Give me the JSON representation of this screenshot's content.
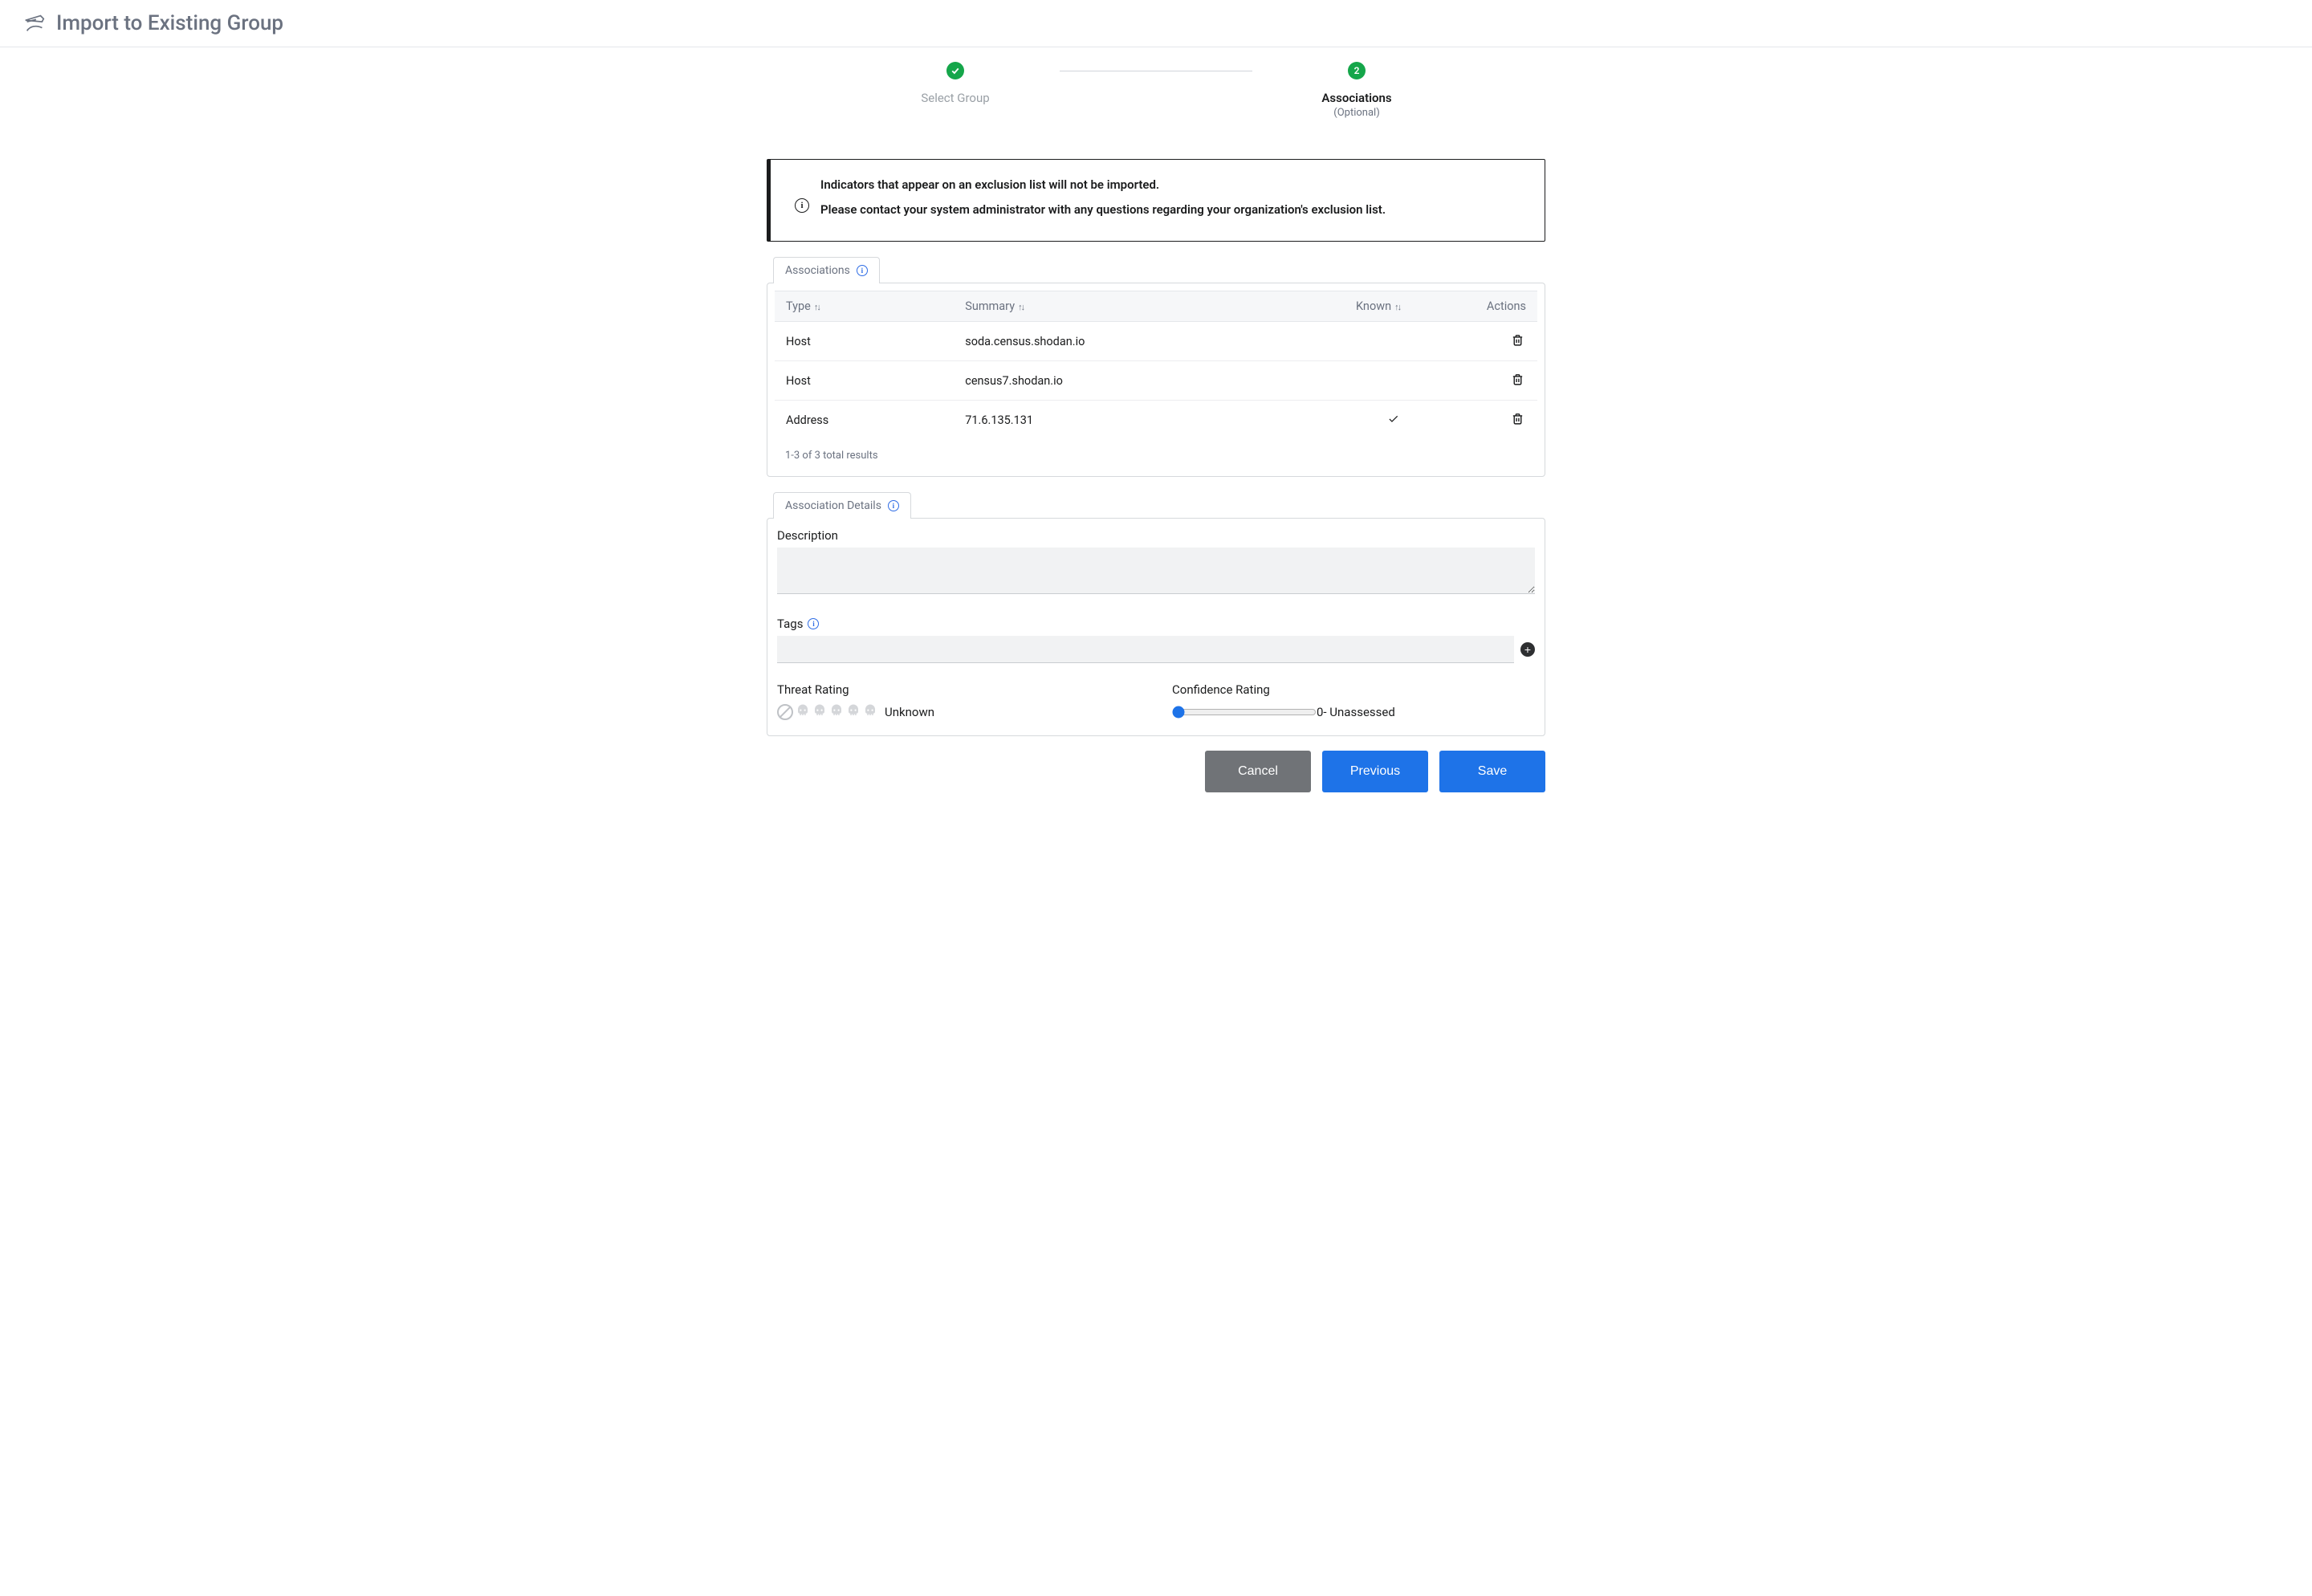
{
  "header": {
    "title": "Import to Existing Group"
  },
  "stepper": {
    "step1": {
      "label": "Select Group",
      "circle": "✓"
    },
    "step2": {
      "label": "Associations",
      "sub": "(Optional)",
      "circle": "2"
    }
  },
  "notice": {
    "line1": "Indicators that appear on an exclusion list will not be imported.",
    "line2": "Please contact your system administrator with any questions regarding your organization's exclusion list."
  },
  "associations_tab": {
    "label": "Associations"
  },
  "table": {
    "headers": {
      "type": "Type",
      "summary": "Summary",
      "known": "Known",
      "actions": "Actions"
    },
    "rows": [
      {
        "type": "Host",
        "summary": "soda.census.shodan.io",
        "known": false
      },
      {
        "type": "Host",
        "summary": "census7.shodan.io",
        "known": false
      },
      {
        "type": "Address",
        "summary": "71.6.135.131",
        "known": true
      }
    ],
    "footer": "1-3 of 3 total results"
  },
  "details_tab": {
    "label": "Association Details"
  },
  "details": {
    "description_label": "Description",
    "tags_label": "Tags",
    "threat_label": "Threat Rating",
    "threat_value": "Unknown",
    "confidence_label": "Confidence Rating",
    "confidence_value": "0- Unassessed"
  },
  "buttons": {
    "cancel": "Cancel",
    "previous": "Previous",
    "save": "Save"
  }
}
